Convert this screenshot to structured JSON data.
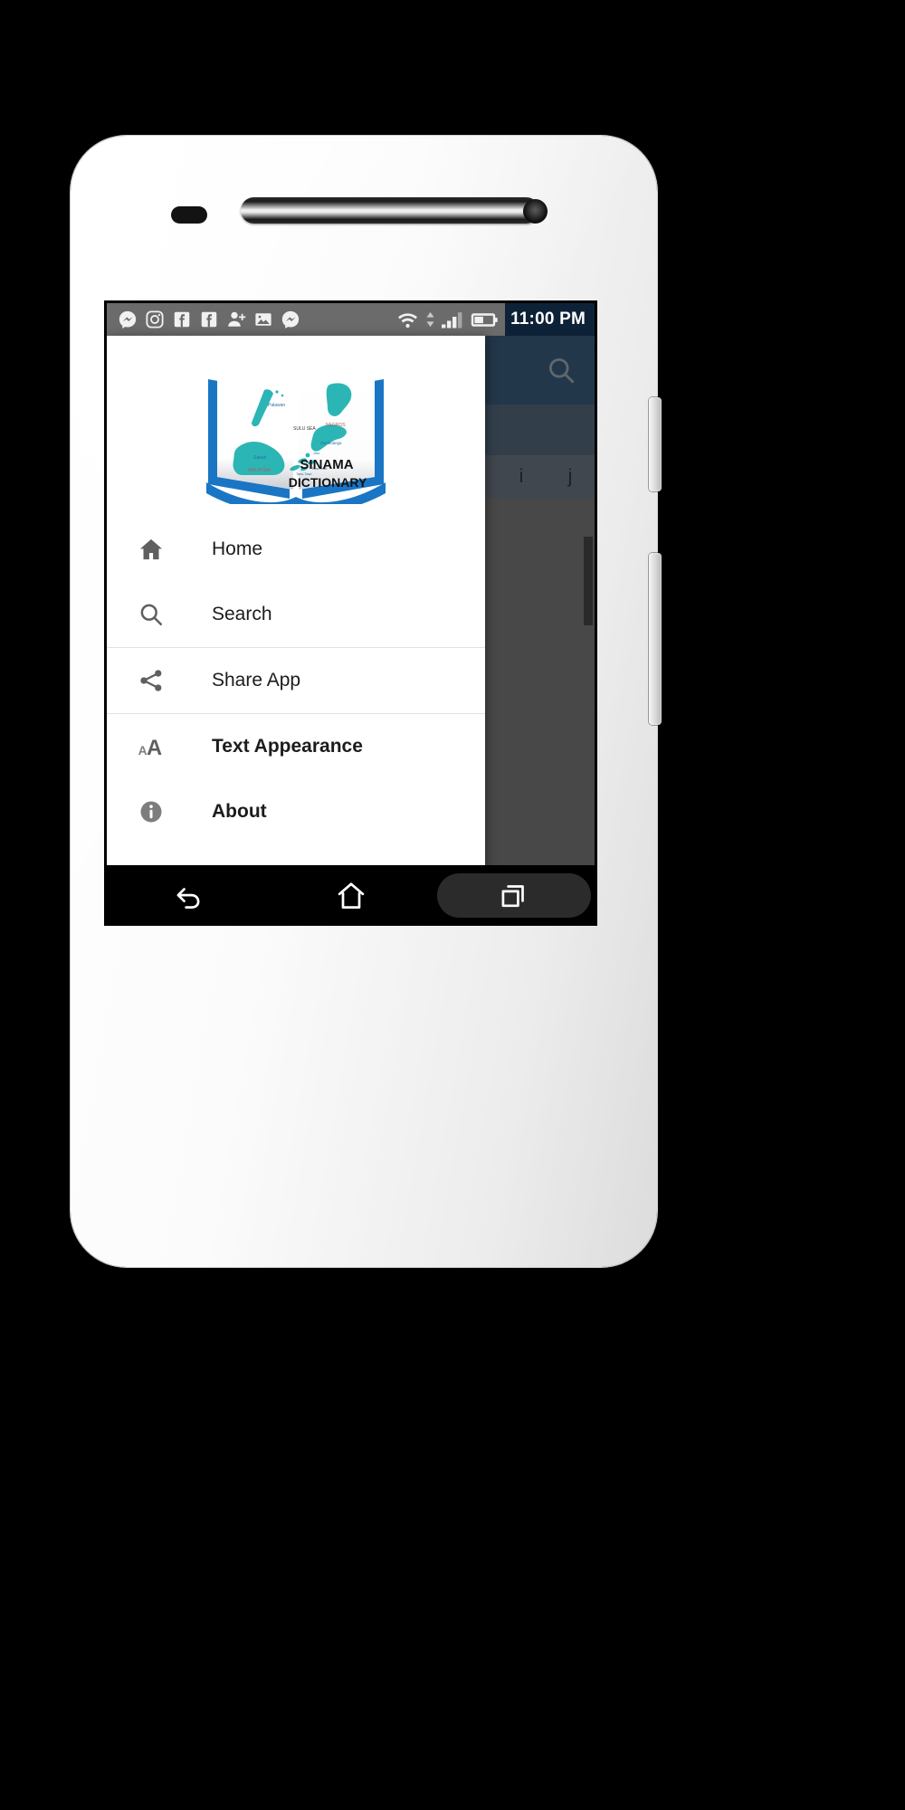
{
  "device": {
    "name": "white-android-phone-mockup",
    "hardware": {
      "sensor": "proximity-sensor",
      "earpiece": "earpiece-speaker",
      "front_camera": "front-camera",
      "power_button": "power-button",
      "volume_button": "volume-rocker"
    }
  },
  "status_bar": {
    "background": "#6b6b6b",
    "clock_background": "#0d2236",
    "time": "11:00 PM",
    "notification_icons": [
      "messenger-icon",
      "instagram-icon",
      "facebook-icon",
      "facebook-icon",
      "add-friend-icon",
      "photo-icon",
      "messenger-icon"
    ],
    "system_icons": [
      "wifi-icon",
      "data-transfer-icon",
      "signal-icon",
      "battery-icon"
    ]
  },
  "activity": {
    "appbar": {
      "background": "#1b4a72",
      "search_icon": "search-icon"
    },
    "tabstrip": {
      "background": "#3f5c75"
    },
    "letter_tabs": [
      "i",
      "j"
    ],
    "list_background": "#6f6f6f",
    "scrim": "rgba(40,40,40,0.55)"
  },
  "drawer": {
    "background": "#ffffff",
    "logo": {
      "name": "sinama-dictionary-logo",
      "title_line1": "SINAMA",
      "title_line2": "DICTIONARY",
      "book_color": "#1a76c4",
      "map_color": "#2cb5b5",
      "map_labels": [
        "Palawan",
        "SULU SEA",
        "NEGROS",
        "Zamboanga",
        "Jolo",
        "Siasi",
        "Tawi-Tawi",
        "Sabah",
        "MALAYSIA"
      ]
    },
    "groups": [
      {
        "name": "navigation-group",
        "items": [
          {
            "label": "Home",
            "icon": "home-icon",
            "bold": false
          },
          {
            "label": "Search",
            "icon": "search-icon",
            "bold": false
          }
        ]
      },
      {
        "name": "share-group",
        "items": [
          {
            "label": "Share App",
            "icon": "share-icon",
            "bold": false
          }
        ]
      },
      {
        "name": "settings-group",
        "items": [
          {
            "label": "Text Appearance",
            "icon": "text-size-icon",
            "bold": true
          },
          {
            "label": "About",
            "icon": "info-icon",
            "bold": true
          }
        ]
      }
    ]
  },
  "navigation_bar": {
    "background": "#000000",
    "buttons": [
      {
        "name": "back-button",
        "icon": "back-arrow-icon",
        "highlighted": false
      },
      {
        "name": "home-button",
        "icon": "home-outline-icon",
        "highlighted": false
      },
      {
        "name": "recents-button",
        "icon": "recents-icon",
        "highlighted": true
      }
    ]
  }
}
